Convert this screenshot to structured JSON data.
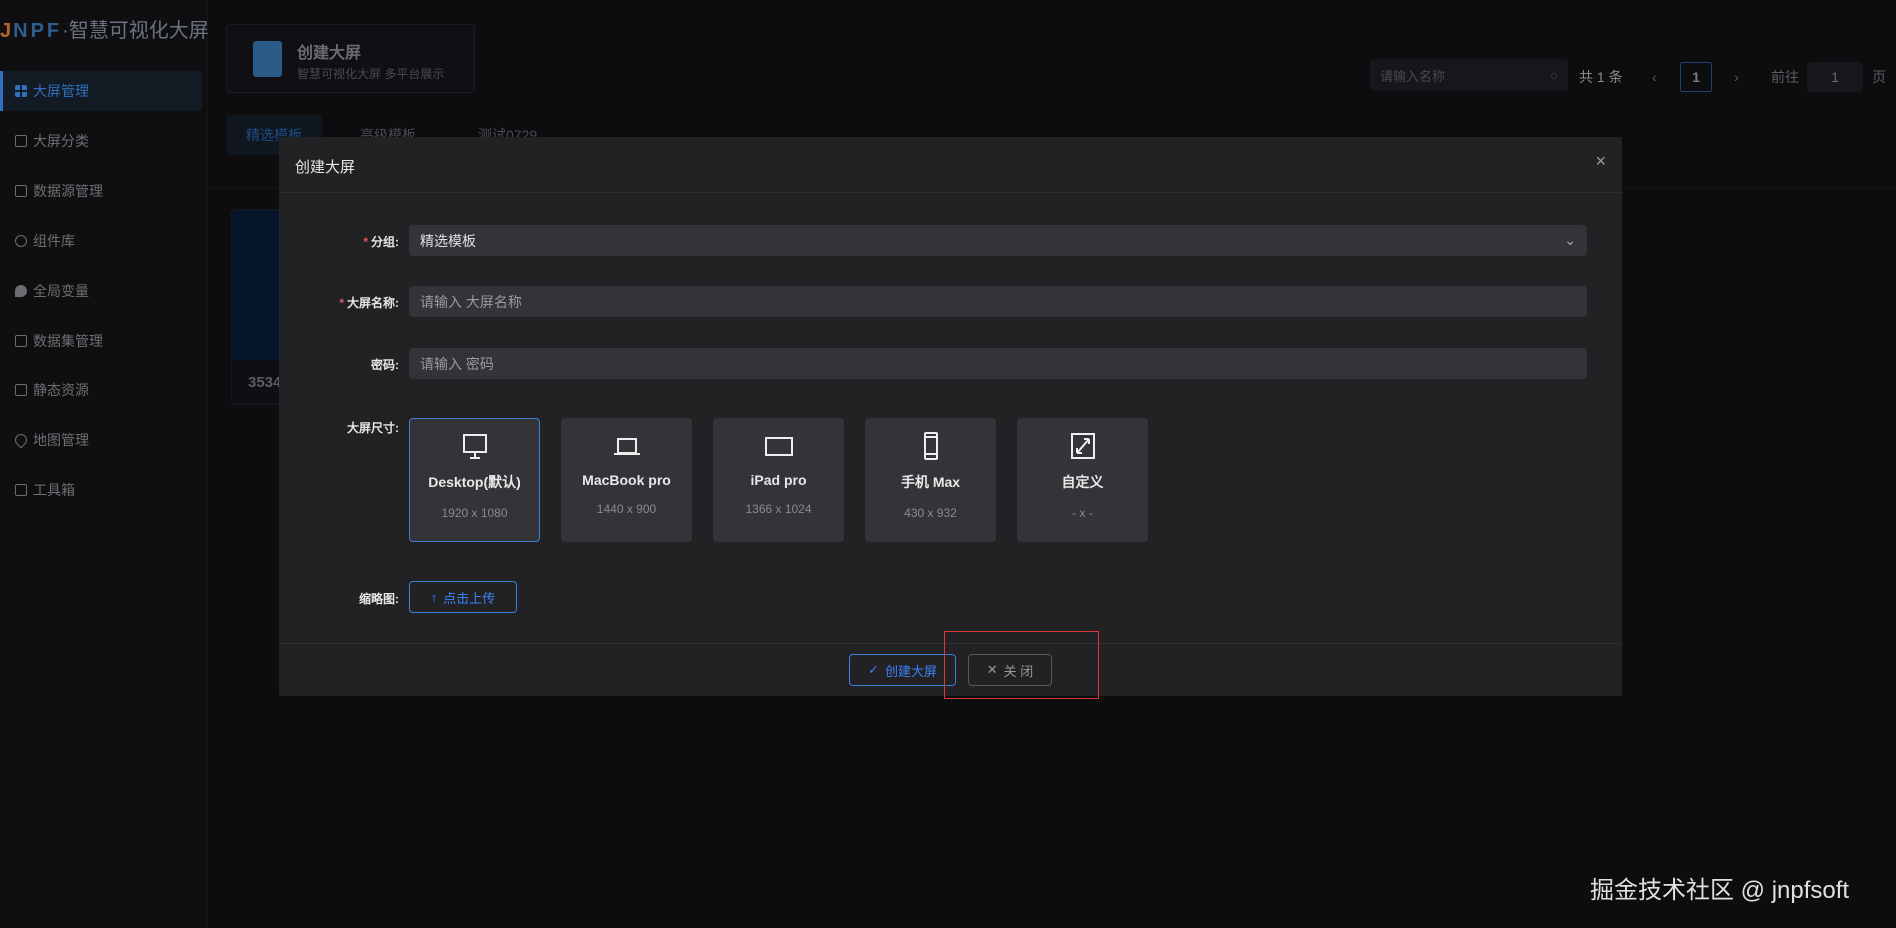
{
  "logo": {
    "j": "J",
    "npf": "NPF",
    "sep": "·",
    "name": "智慧可视化大屏"
  },
  "sidebar": {
    "items": [
      {
        "label": "大屏管理",
        "icon": "grid-icon",
        "active": true
      },
      {
        "label": "大屏分类",
        "icon": "folder-icon"
      },
      {
        "label": "数据源管理",
        "icon": "database-icon"
      },
      {
        "label": "组件库",
        "icon": "component-icon"
      },
      {
        "label": "全局变量",
        "icon": "bulb-icon"
      },
      {
        "label": "数据集管理",
        "icon": "dataset-icon"
      },
      {
        "label": "静态资源",
        "icon": "resource-icon"
      },
      {
        "label": "地图管理",
        "icon": "map-pin-icon"
      },
      {
        "label": "工具箱",
        "icon": "toolbox-icon"
      }
    ]
  },
  "header_card": {
    "title": "创建大屏",
    "subtitle": "智慧可视化大屏 多平台展示"
  },
  "tabs": [
    {
      "label": "精选模板",
      "active": true
    },
    {
      "label": "高级模板"
    },
    {
      "label": "测试0729"
    }
  ],
  "search": {
    "placeholder": "请输入名称"
  },
  "pagination": {
    "total": "共 1 条",
    "prev": "‹",
    "current": "1",
    "next": "›",
    "goto": "前往",
    "goto_value": "1",
    "page_unit": "页"
  },
  "card": {
    "title": "3534"
  },
  "modal": {
    "title": "创建大屏",
    "close": "×",
    "group": {
      "label": "分组:",
      "value": "精选模板"
    },
    "name": {
      "label": "大屏名称:",
      "placeholder": "请输入 大屏名称"
    },
    "password": {
      "label": "密码:",
      "placeholder": "请输入 密码"
    },
    "size": {
      "label": "大屏尺寸:",
      "options": [
        {
          "name": "Desktop(默认)",
          "dims": "1920 x 1080",
          "icon": "monitor-icon",
          "selected": true
        },
        {
          "name": "MacBook pro",
          "dims": "1440 x 900",
          "icon": "laptop-icon"
        },
        {
          "name": "iPad pro",
          "dims": "1366 x 1024",
          "icon": "tablet-icon"
        },
        {
          "name": "手机 Max",
          "dims": "430 x 932",
          "icon": "phone-icon"
        },
        {
          "name": "自定义",
          "dims": "- x -",
          "icon": "expand-icon"
        }
      ]
    },
    "thumbnail": {
      "label": "缩略图:",
      "button": "点击上传"
    },
    "footer": {
      "create": "创建大屏",
      "close": "关 闭"
    }
  },
  "watermark": "掘金技术社区 @ jnpfsoft",
  "colors": {
    "accent": "#3b82f6",
    "highlight": "#d83a3a",
    "modal_bg": "#222224",
    "field_bg": "#333438"
  }
}
